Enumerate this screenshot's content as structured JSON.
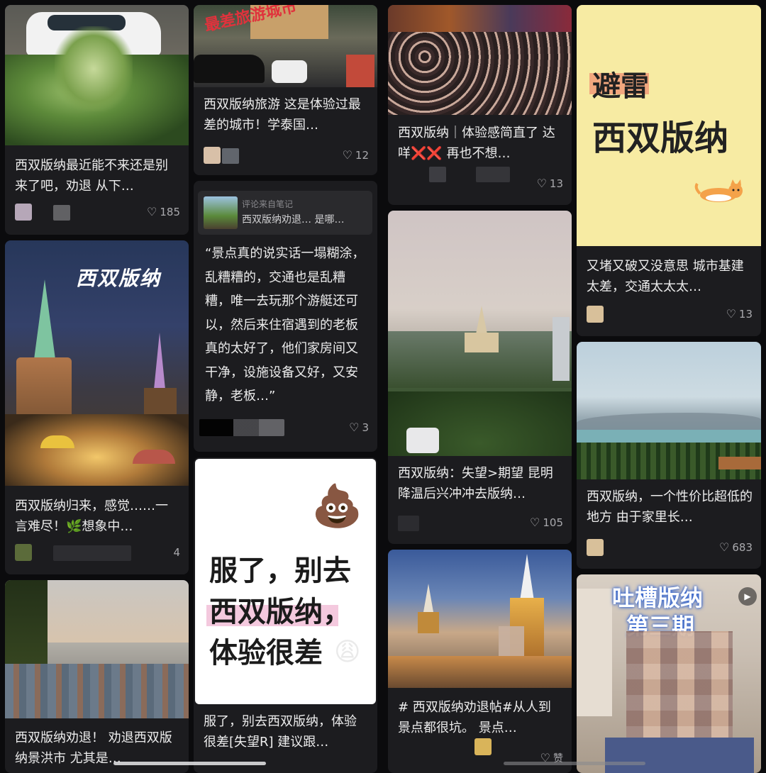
{
  "cards": {
    "c1": {
      "title": "西双版纳最近能不来还是别来了吧，劝退 从下…",
      "likes": "185"
    },
    "c2": {
      "overlay": "最差旅游城市",
      "title": "西双版纳旅游 这是体验过最差的城市！学泰国…",
      "likes": "12"
    },
    "c3": {
      "title": "西双版纳｜体验感简直了 达咩❌❌ 再也不想…",
      "likes": "13"
    },
    "c4": {
      "cover_line1": "避雷",
      "cover_line2": "西双版纳",
      "title": "又堵又破又没意思 城市基建太差，交通太太太…",
      "likes": "13"
    },
    "c5": {
      "comment_source": "评论来自笔记",
      "comment_note": "西双版纳劝退… 是哪…",
      "quote": "“景点真的说实话一塌糊涂，乱糟糟的，交通也是乱糟糟，唯一去玩那个游艇还可以，然后来住宿遇到的老板真的太好了，他们家房间又干净，设施设备又好，又安静，老板…”",
      "likes": "3"
    },
    "c6": {
      "overlay": "西双版纳",
      "title": "西双版纳归来，感觉……一言难尽！🌿想象中…",
      "likes": "4"
    },
    "c7": {
      "title": "西双版纳：失望>期望 昆明降温后兴冲冲去版纳…",
      "likes": "105"
    },
    "c8": {
      "title": "西双版纳，一个性价比超低的地方 由于家里长…",
      "likes": "683"
    },
    "c9": {
      "emoji": "💩",
      "line1": "服了，别去",
      "line2": "西双版纳，",
      "line3": "体验很差",
      "sticker": "😩",
      "title": "服了，别去西双版纳，体验很差[失望R] 建议跟…"
    },
    "c10": {
      "title": "西双版纳劝退！ 劝退西双版纳景洪市 尤其是…"
    },
    "c11": {
      "title": "# 西双版纳劝退帖#从人到景点都很坑。 景点…",
      "likes": "赞"
    },
    "c12": {
      "overlay_line1": "吐槽版纳",
      "overlay_line2": "第三期"
    }
  },
  "icons": {
    "heart": "♡",
    "play": "▶"
  }
}
